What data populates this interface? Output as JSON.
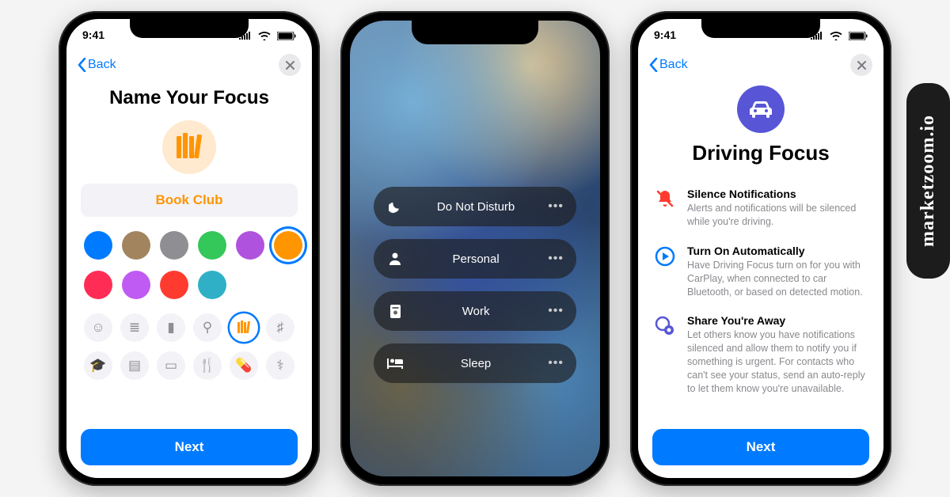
{
  "watermark": "marketzoom.io",
  "status": {
    "time": "9:41"
  },
  "nav": {
    "back": "Back"
  },
  "phone1": {
    "title": "Name Your Focus",
    "focus_name": "Book Club",
    "colors": [
      {
        "hex": "#007aff",
        "selected": false
      },
      {
        "hex": "#a2845e",
        "selected": false
      },
      {
        "hex": "#8e8e93",
        "selected": false
      },
      {
        "hex": "#34c759",
        "selected": false
      },
      {
        "hex": "#af52de",
        "selected": false
      },
      {
        "hex": "#ff9500",
        "selected": true
      },
      {
        "hex": "#ff2d55",
        "selected": false
      },
      {
        "hex": "#bf5af2",
        "selected": false
      },
      {
        "hex": "#ff3b30",
        "selected": false
      },
      {
        "hex": "#30b0c7",
        "selected": false
      }
    ],
    "glyphs": [
      {
        "char": "☺",
        "name": "smile-icon",
        "selected": false
      },
      {
        "char": "≣",
        "name": "list-icon",
        "selected": false
      },
      {
        "char": "▮",
        "name": "bookmark-icon",
        "selected": false
      },
      {
        "char": "⚲",
        "name": "key-icon",
        "selected": false
      },
      {
        "char": "▮▮▮",
        "name": "books-icon",
        "selected": true
      },
      {
        "char": "♯",
        "name": "gift-icon",
        "selected": false
      },
      {
        "char": "🎓",
        "name": "graduation-icon",
        "selected": false
      },
      {
        "char": "▤",
        "name": "document-icon",
        "selected": false
      },
      {
        "char": "▭",
        "name": "card-icon",
        "selected": false
      },
      {
        "char": "🍴",
        "name": "food-icon",
        "selected": false
      },
      {
        "char": "💊",
        "name": "pills-icon",
        "selected": false
      },
      {
        "char": "⚕",
        "name": "stethoscope-icon",
        "selected": false
      }
    ],
    "next": "Next"
  },
  "phone2": {
    "modes": [
      {
        "label": "Do Not Disturb",
        "icon": "moon-icon"
      },
      {
        "label": "Personal",
        "icon": "person-icon"
      },
      {
        "label": "Work",
        "icon": "badge-icon"
      },
      {
        "label": "Sleep",
        "icon": "bed-icon"
      }
    ]
  },
  "phone3": {
    "title": "Driving Focus",
    "features": [
      {
        "icon": "bell-slash-icon",
        "title": "Silence Notifications",
        "desc": "Alerts and notifications will be silenced while you're driving."
      },
      {
        "icon": "play-circle-icon",
        "title": "Turn On Automatically",
        "desc": "Have Driving Focus turn on for you with CarPlay, when connected to car Bluetooth, or based on detected motion."
      },
      {
        "icon": "share-status-icon",
        "title": "Share You're Away",
        "desc": "Let others know you have notifications silenced and allow them to notify you if something is urgent. For contacts who can't see your status, send an auto-reply to let them know you're unavailable."
      }
    ],
    "next": "Next"
  }
}
